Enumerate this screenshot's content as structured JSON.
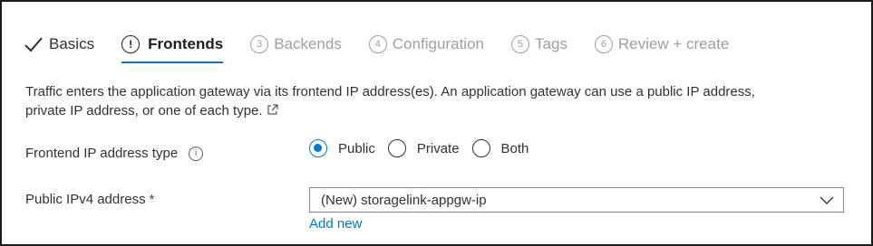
{
  "tabs": [
    {
      "label": "Basics",
      "number": "",
      "state": "completed"
    },
    {
      "label": "Frontends",
      "number": "!",
      "state": "active"
    },
    {
      "label": "Backends",
      "number": "3",
      "state": "disabled"
    },
    {
      "label": "Configuration",
      "number": "4",
      "state": "disabled"
    },
    {
      "label": "Tags",
      "number": "5",
      "state": "disabled"
    },
    {
      "label": "Review + create",
      "number": "6",
      "state": "disabled"
    }
  ],
  "description": {
    "line1": "Traffic enters the application gateway via its frontend IP address(es). An application gateway can use a public IP address,",
    "line2": "private IP address, or one of each type."
  },
  "frontend_ip_type": {
    "label": "Frontend IP address type",
    "info_icon": "i",
    "options": [
      {
        "label": "Public",
        "selected": true
      },
      {
        "label": "Private",
        "selected": false
      },
      {
        "label": "Both",
        "selected": false
      }
    ]
  },
  "public_ipv4": {
    "label": "Public IPv4 address",
    "required_marker": "*",
    "value": "(New) storagelink-appgw-ip",
    "add_new_label": "Add new"
  },
  "colors": {
    "accent": "#0078d4",
    "disabled_text": "#a19f9d",
    "required": "#a4262c"
  }
}
